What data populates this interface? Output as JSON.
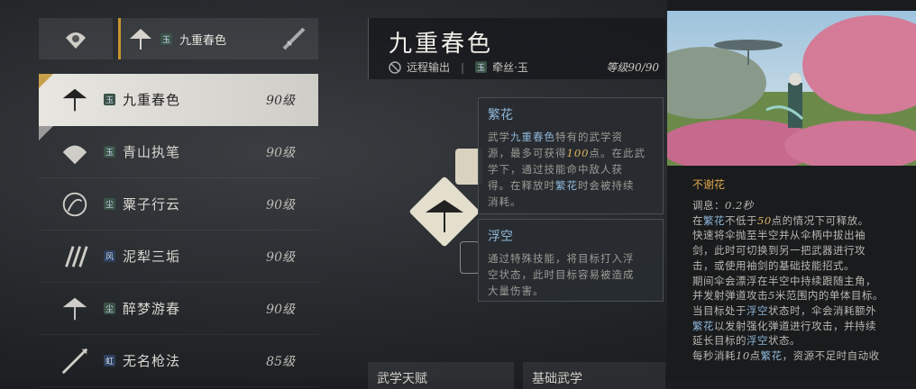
{
  "top_bar": {
    "item_badge": "玉",
    "item_name": "九重春色"
  },
  "weapon_list": [
    {
      "badge": "玉",
      "name": "九重春色",
      "level": "90级",
      "selected": true,
      "icon": "umbrella-icon"
    },
    {
      "badge": "玉",
      "name": "青山执笔",
      "level": "90级",
      "icon": "fan-icon"
    },
    {
      "badge": "尘",
      "name": "粟子行云",
      "level": "90级",
      "icon": "swirl-icon"
    },
    {
      "badge": "风",
      "name": "泥犁三垢",
      "level": "90级",
      "icon": "claws-icon"
    },
    {
      "badge": "尘",
      "name": "醉梦游春",
      "level": "90级",
      "icon": "umbrella-icon"
    },
    {
      "badge": "虹",
      "name": "无名枪法",
      "level": "85级",
      "icon": "spear-icon"
    }
  ],
  "header": {
    "title": "九重春色",
    "role": "远程输出",
    "separator": "|",
    "badge": "玉",
    "sub": "牵丝·玉",
    "grade": "等级90/90"
  },
  "tip1": {
    "title": "繁花",
    "lines": [
      "武学九重春色特有的武学资",
      "源，最多可获得100点。在此武",
      "学下，通过技能命中敌人获",
      "得。在释放时繁花时会被持续",
      "消耗。"
    ]
  },
  "tip2": {
    "title": "浮空",
    "lines": [
      "通过特殊技能，将目标打入浮",
      "空状态，此时目标容易被造成",
      "大量伤害。"
    ]
  },
  "bottom_tabs": [
    "武学天赋",
    "基础武学"
  ],
  "skill": {
    "name": "不谢花",
    "lines": [
      "调息：0.2秒",
      "在繁花不低于50点的情况下可释放。",
      "快速将伞抛至半空并从伞柄中拔出袖",
      "剑，此时可切换到另一把武器进行攻",
      "击，或使用袖剑的基础技能招式。",
      "期间伞会漂浮在半空中持续跟随主角，",
      "并发射弹道攻击5米范围内的单体目标。",
      "当目标处于浮空状态时，伞会消耗额外",
      "繁花以发射强化弹道进行攻击，并持续",
      "延长目标的浮空状态。",
      "每秒消耗10点繁花，资源不足时自动收"
    ]
  }
}
